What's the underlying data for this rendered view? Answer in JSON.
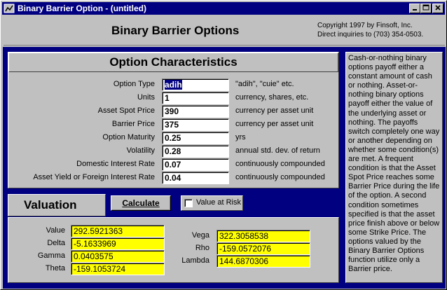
{
  "window": {
    "title": "Binary Barrier Option - (untitled)",
    "min_icon": "minimize-icon",
    "max_icon": "maximize-icon",
    "close_icon": "close-icon"
  },
  "header": {
    "app_title": "Binary Barrier Options",
    "copyright": "Copyright 1997 by Finsoft, Inc.",
    "inquiries": "Direct inquiries to (703) 354-0503."
  },
  "characteristics": {
    "title": "Option Characteristics",
    "rows": [
      {
        "label": "Option Type",
        "value": "adih",
        "unit": "\"adih\", \"cuie\" etc."
      },
      {
        "label": "Units",
        "value": "1",
        "unit": "currency, shares, etc."
      },
      {
        "label": "Asset Spot Price",
        "value": "390",
        "unit": "currency per asset unit"
      },
      {
        "label": "Barrier Price",
        "value": "375",
        "unit": "currency per asset unit"
      },
      {
        "label": "Option Maturity",
        "value": "0.25",
        "unit": "yrs"
      },
      {
        "label": "Volatility",
        "value": "0.28",
        "unit": "annual std. dev. of return"
      },
      {
        "label": "Domestic Interest Rate",
        "value": "0.07",
        "unit": "continuously compounded"
      },
      {
        "label": "Asset Yield or Foreign Interest Rate",
        "value": "0.04",
        "unit": "continuously compounded"
      }
    ]
  },
  "valuation": {
    "title": "Valuation",
    "calculate_label": "Calculate",
    "var_label": "Value at Risk",
    "left": [
      {
        "label": "Value",
        "value": "292.5921363"
      },
      {
        "label": "Delta",
        "value": "-5.1633969"
      },
      {
        "label": "Gamma",
        "value": "0.0403575"
      },
      {
        "label": "Theta",
        "value": "-159.1053724"
      }
    ],
    "right": [
      {
        "label": "Vega",
        "value": "322.3058538"
      },
      {
        "label": "Rho",
        "value": "-159.0572076"
      },
      {
        "label": "Lambda",
        "value": "144.6870306"
      }
    ]
  },
  "description": "Cash-or-nothing binary options payoff either a constant amount of cash or nothing.  Asset-or-nothing binary options payoff either the value of the underlying asset or nothing.  The payoffs switch completely one way or another depending on whether some condition(s) are met. A frequent condition is that the Asset Spot Price reaches some Barrier Price during the life of the option. A second condition sometimes specified is that the asset price finish above or below some Strike Price. The options valued by the Binary Barrier Options function utilize only a Barrier price."
}
